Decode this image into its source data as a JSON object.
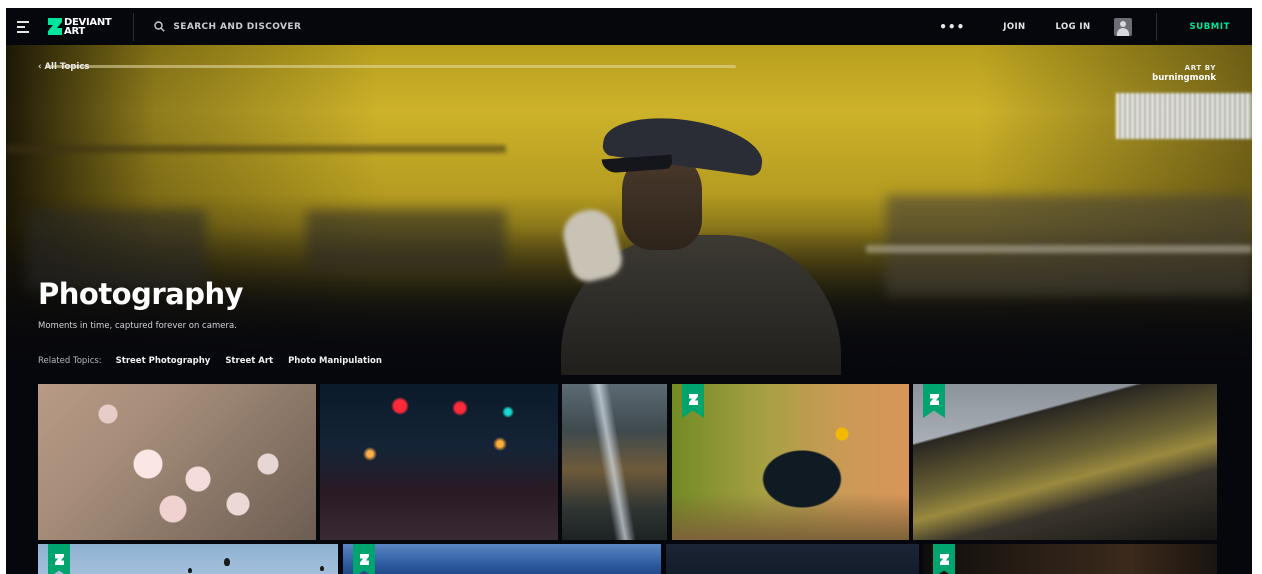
{
  "header": {
    "logo_line1": "DEVIANT",
    "logo_line2": "ART",
    "search_placeholder": "SEARCH AND DISCOVER",
    "more_label": "•••",
    "join_label": "JOIN",
    "login_label": "LOG IN",
    "submit_label": "SUBMIT",
    "accent_color": "#00e59b"
  },
  "hero": {
    "back_link": "‹ All Topics",
    "art_by_label": "ART BY",
    "artist": "burningmonk",
    "title": "Photography",
    "subtitle": "Moments in time, captured forever on camera.",
    "related_label": "Related Topics:",
    "related_topics": [
      "Street Photography",
      "Street Art",
      "Photo Manipulation"
    ]
  },
  "gallery": {
    "badge_icon": "deviantart-logo-icon",
    "badge_color": "#00a46e",
    "tiles": [
      {
        "subject": "cherry-blossoms",
        "badge": false
      },
      {
        "subject": "night-city-street",
        "badge": false
      },
      {
        "subject": "waterfall",
        "badge": false
      },
      {
        "subject": "starling-bird",
        "badge": true
      },
      {
        "subject": "mountain-landscape",
        "badge": true
      },
      {
        "subject": "hot-air-balloons",
        "badge": true
      },
      {
        "subject": "mountains-blue-sky",
        "badge": true
      },
      {
        "subject": "dark-forest",
        "badge": false
      },
      {
        "subject": "dark-interior",
        "badge": true
      }
    ]
  }
}
